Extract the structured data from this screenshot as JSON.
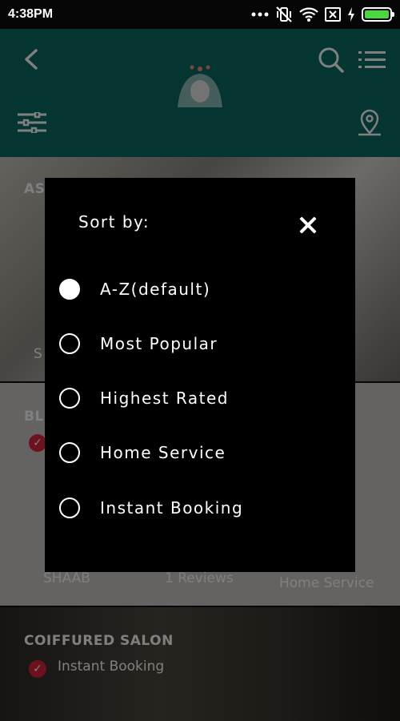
{
  "status_bar": {
    "time": "4:38PM",
    "icons": [
      "more-dots-icon",
      "vibrate-off-icon",
      "wifi-icon",
      "sim-off-icon",
      "charging-icon",
      "battery-icon"
    ],
    "battery_color": "#49d83d"
  },
  "header": {
    "color": "#0a6b63",
    "icons": [
      "back-icon",
      "app-logo",
      "search-icon",
      "list-view-icon",
      "filter-icon",
      "map-pin-icon"
    ]
  },
  "listings": [
    {
      "title": "AS",
      "extra": "S"
    },
    {
      "title": "BL",
      "location": "SHAAB",
      "reviews": "1 Reviews",
      "service": "Home Service"
    },
    {
      "title": "COIFFURED SALON",
      "badge": "Instant Booking"
    }
  ],
  "sort_dialog": {
    "title": "Sort by:",
    "options": [
      {
        "label": "A-Z(default)",
        "selected": true
      },
      {
        "label": "Most Popular",
        "selected": false
      },
      {
        "label": "Highest Rated",
        "selected": false
      },
      {
        "label": "Home Service",
        "selected": false
      },
      {
        "label": "Instant Booking",
        "selected": false
      }
    ]
  },
  "colors": {
    "accent_check": "#d8223a",
    "dialog_bg": "#000000"
  }
}
